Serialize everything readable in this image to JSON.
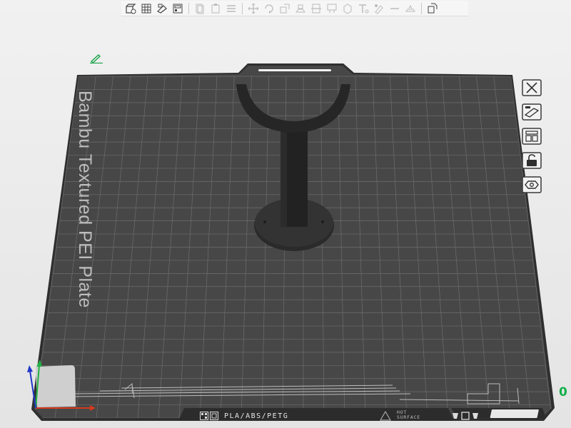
{
  "toolbar": {
    "items": [
      {
        "name": "add-object-icon"
      },
      {
        "name": "grid-icon"
      },
      {
        "name": "auto-orient-icon"
      },
      {
        "name": "arrange-icon"
      },
      {
        "sep": true
      },
      {
        "name": "copy-icon"
      },
      {
        "name": "paste-icon"
      },
      {
        "name": "menu-icon"
      },
      {
        "sep": true
      },
      {
        "name": "move-icon"
      },
      {
        "name": "rotate-icon"
      },
      {
        "name": "scale-icon"
      },
      {
        "name": "lay-on-face-icon"
      },
      {
        "name": "cut-icon"
      },
      {
        "name": "support-paint-icon"
      },
      {
        "name": "seam-paint-icon"
      },
      {
        "name": "text-icon"
      },
      {
        "name": "color-paint-icon"
      },
      {
        "name": "measure-icon"
      },
      {
        "name": "assembly-icon"
      },
      {
        "sep": true
      },
      {
        "name": "split-icon"
      }
    ]
  },
  "plate": {
    "name": "Bambu Textured PEI Plate",
    "filament_types": "PLA/ABS/PETG",
    "warning_line1": "HOT",
    "warning_line2": "SURFACE"
  },
  "side_tools": [
    {
      "name": "delete-plate-icon"
    },
    {
      "name": "auto-arrange-icon"
    },
    {
      "name": "plate-settings-icon"
    },
    {
      "name": "lock-icon"
    },
    {
      "name": "filament-settings-icon"
    }
  ],
  "plate_index": "0",
  "colors": {
    "plate": "#474747",
    "plate_edge": "#2f2f2f",
    "grid": "#6f6f6f",
    "model": "#2a2a2a",
    "accent": "#12b04a"
  }
}
